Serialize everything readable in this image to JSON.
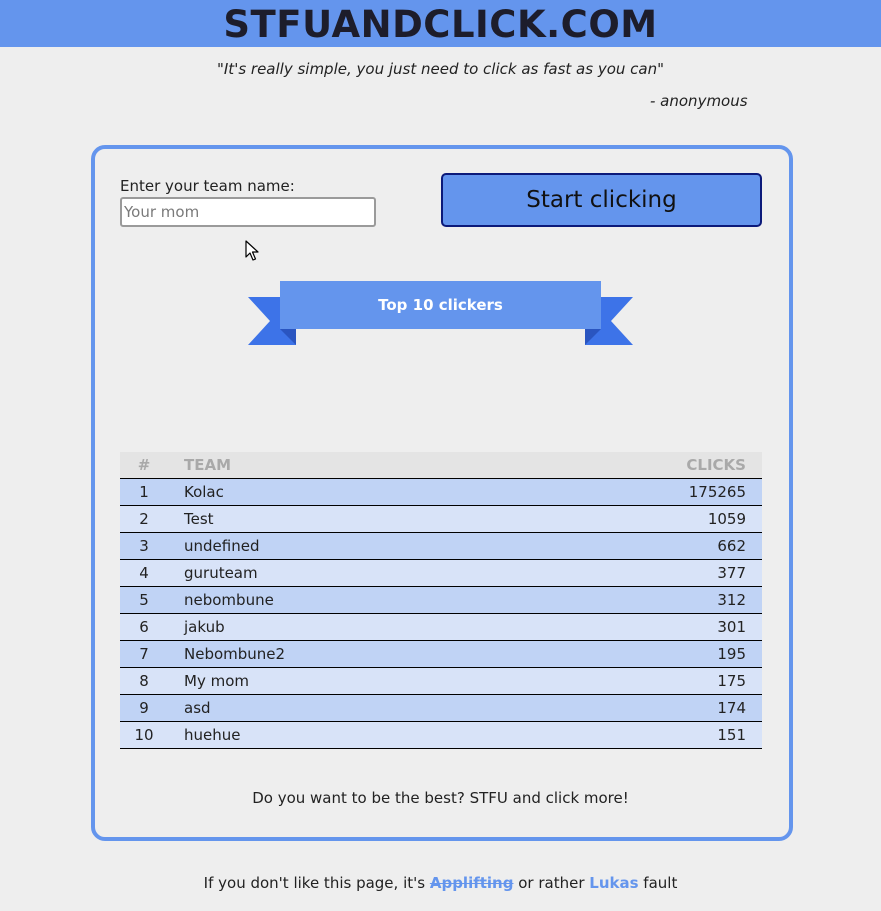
{
  "header": {
    "title": "STFUANDCLICK.COM"
  },
  "quote": {
    "text": "\"It's really simple, you just need to click as fast as you can\"",
    "author": "- anonymous"
  },
  "form": {
    "label": "Enter your team name:",
    "placeholder": "Your mom",
    "value": "",
    "start_button_label": "Start clicking"
  },
  "ribbon": {
    "title": "Top 10 clickers"
  },
  "leaderboard": {
    "columns": [
      "#",
      "TEAM",
      "CLICKS"
    ],
    "rows": [
      {
        "rank": "1",
        "team": "Kolac",
        "clicks": "175265"
      },
      {
        "rank": "2",
        "team": "Test",
        "clicks": "1059"
      },
      {
        "rank": "3",
        "team": "undefined",
        "clicks": "662"
      },
      {
        "rank": "4",
        "team": "guruteam",
        "clicks": "377"
      },
      {
        "rank": "5",
        "team": "nebombune",
        "clicks": "312"
      },
      {
        "rank": "6",
        "team": "jakub",
        "clicks": "301"
      },
      {
        "rank": "7",
        "team": "Nebombune2",
        "clicks": "195"
      },
      {
        "rank": "8",
        "team": "My mom",
        "clicks": "175"
      },
      {
        "rank": "9",
        "team": "asd",
        "clicks": "174"
      },
      {
        "rank": "10",
        "team": "huehue",
        "clicks": "151"
      }
    ]
  },
  "card_footer": {
    "text": "Do you want to be the best? STFU and click more!"
  },
  "page_footer": {
    "prefix": "If you don't like this page, it's ",
    "link1": "Applifting",
    "middle": " or rather ",
    "link2": "Lukas",
    "suffix": " fault"
  },
  "colors": {
    "accent": "#6495ed",
    "background": "#eeeeee",
    "row_odd": "#c0d3f5",
    "row_even": "#d8e3f8",
    "button_border": "#0c1a7a"
  }
}
